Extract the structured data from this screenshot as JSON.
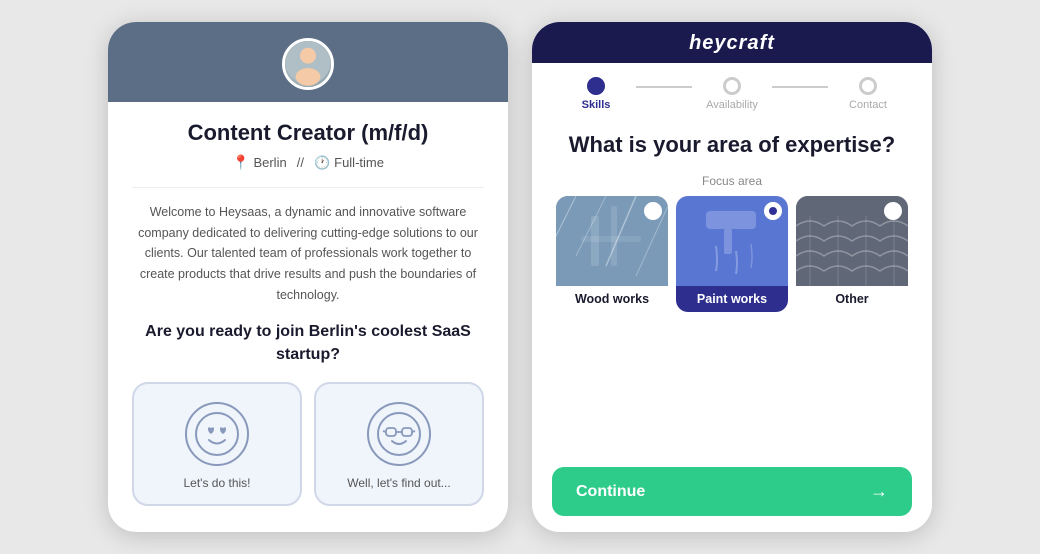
{
  "left_phone": {
    "job_title": "Content Creator (m/f/d)",
    "location": "Berlin",
    "work_type": "Full-time",
    "description": "Welcome to Heysaas, a dynamic and innovative software company dedicated to delivering cutting-edge solutions to our clients. Our talented team of professionals work together to create products that drive results and push the boundaries of technology.",
    "cta": "Are you ready to join Berlin's coolest SaaS startup?",
    "option1_label": "Let's do this!",
    "option2_label": "Well, let's find out..."
  },
  "right_phone": {
    "brand": "heycraft",
    "steps": [
      {
        "label": "Skills",
        "active": true
      },
      {
        "label": "Availability",
        "active": false
      },
      {
        "label": "Contact",
        "active": false
      }
    ],
    "question": "What is your area of expertise?",
    "focus_label": "Focus area",
    "skills": [
      {
        "id": "wood",
        "label": "Wood works",
        "selected": false
      },
      {
        "id": "paint",
        "label": "Paint works",
        "selected": true
      },
      {
        "id": "other",
        "label": "Other",
        "selected": false
      }
    ],
    "continue_label": "Continue",
    "arrow": "→"
  }
}
